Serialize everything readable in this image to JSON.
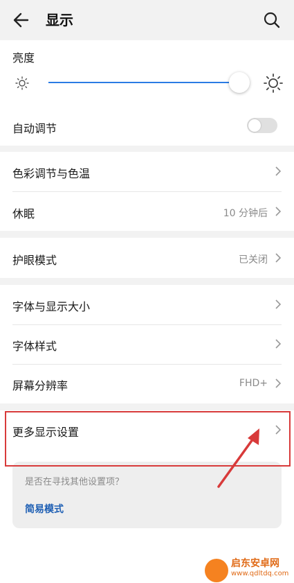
{
  "header": {
    "title": "显示"
  },
  "brightness": {
    "label": "亮度",
    "level": 0.95
  },
  "auto_adjust": {
    "label": "自动调节",
    "on": false
  },
  "items": [
    {
      "label": "色彩调节与色温",
      "value": ""
    },
    {
      "label": "休眠",
      "value": "10 分钟后"
    },
    {
      "label": "护眼模式",
      "value": "已关闭"
    },
    {
      "label": "字体与显示大小",
      "value": ""
    },
    {
      "label": "字体样式",
      "value": ""
    },
    {
      "label": "屏幕分辨率",
      "value": "FHD+"
    },
    {
      "label": "更多显示设置",
      "value": ""
    }
  ],
  "hint": {
    "question": "是否在寻找其他设置项？",
    "link": "简易模式"
  },
  "watermark": {
    "name": "启东安卓网",
    "url": "www.qdltdq.com"
  },
  "colors": {
    "accent": "#2a7be4",
    "link": "#1e5fb4",
    "highlight": "#d83a3a"
  }
}
